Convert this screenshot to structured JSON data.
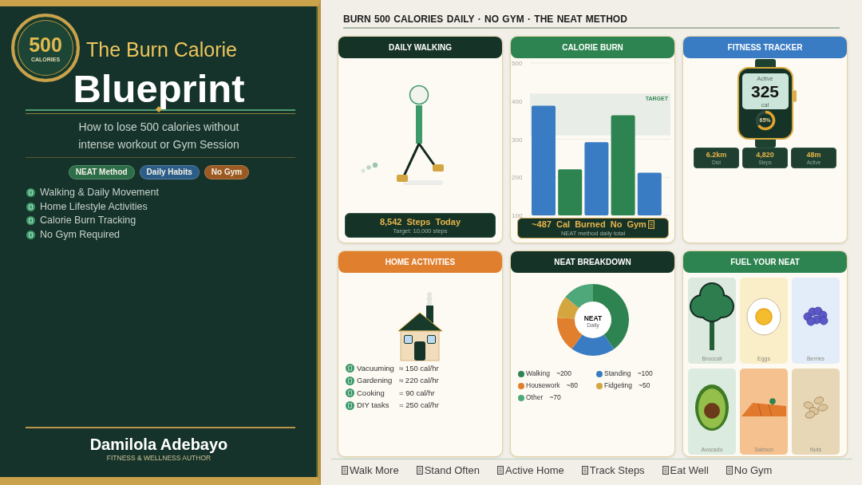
{
  "sidebar": {
    "badge": {
      "value": "500",
      "label": "CALORIES"
    },
    "title": "The Burn Calorie",
    "headline": "Blueprint",
    "subtitle": "How to lose 500 calories without intense workout or Gym Session",
    "tags": [
      {
        "label": "NEAT Method",
        "color": "#2c6e47"
      },
      {
        "label": "Daily Habits",
        "color": "#2b5d88"
      },
      {
        "label": "No Gym",
        "color": "#9b5a22"
      }
    ],
    "features": [
      "Walking & Daily Movement",
      "Home Lifestyle Activities",
      "Calorie Burn Tracking",
      "No Gym Required"
    ],
    "author": {
      "name": "Damilola Adebayo",
      "role": "FITNESS & WELLNESS AUTHOR"
    }
  },
  "header": "BURN 500 CALORIES DAILY · NO GYM · THE NEAT METHOD",
  "cards": [
    {
      "kind": "walking",
      "title": "DAILY WALKING",
      "color": "#163328",
      "summary": "8,542 Steps Today",
      "note": "Target: 10,000 steps"
    },
    {
      "kind": "bar_chart",
      "title": "CALORIE BURN",
      "color": "#2e8450",
      "chart_data": {
        "type": "bar",
        "stacked": true,
        "ylim": [
          100,
          500
        ],
        "yticks": [
          100,
          200,
          300,
          400,
          500
        ],
        "series": [
          {
            "color": "#3a7cc4",
            "values": [
              388,
              null,
              292,
              null,
              212
            ]
          },
          {
            "color": "#2e8450",
            "values": [
              null,
              221,
              null,
              363,
              null
            ]
          }
        ],
        "bands": [
          {
            "axis": "y",
            "from": 310,
            "to": 420,
            "label": "TARGET"
          }
        ]
      },
      "summary": "~487 Cal Burned No Gym",
      "note": "NEAT method daily total"
    },
    {
      "kind": "tracker",
      "title": "FITNESS TRACKER",
      "color": "#3a7cc4",
      "screen_label": "Active",
      "value": "325",
      "unit": "cal",
      "ring": {
        "level": 0.65,
        "label": "65%"
      },
      "stats": [
        {
          "value": "6.2km",
          "label": "Dist"
        },
        {
          "value": "4,820",
          "label": "Steps"
        },
        {
          "value": "48m",
          "label": "Active"
        }
      ]
    },
    {
      "kind": "activities",
      "title": "HOME ACTIVITIES",
      "color": "#e07f2e",
      "activities": [
        {
          "name": "Vacuuming",
          "rate": "≈ 150 cal/hr"
        },
        {
          "name": "Gardening",
          "rate": "≈ 220 cal/hr"
        },
        {
          "name": "Cooking",
          "rate": "= 90 cal/hr"
        },
        {
          "name": "DIY tasks",
          "rate": "= 250 cal/hr"
        }
      ]
    },
    {
      "kind": "donut",
      "title": "NEAT BREAKDOWN",
      "color": "#163328",
      "center_title": "NEAT",
      "center_subtitle": "Daily",
      "chart_data": {
        "type": "donut",
        "categories": [
          "Walking",
          "Standing",
          "Housework",
          "Fidgeting",
          "Other"
        ],
        "values": [
          40,
          20,
          16,
          10,
          14
        ]
      },
      "legend": [
        {
          "value": "~200",
          "color": "#2e8450"
        },
        {
          "value": "~100",
          "color": "#3a7cc4"
        },
        {
          "value": "~80",
          "color": "#e07f2e"
        },
        {
          "value": "~50",
          "color": "#d4a63f"
        },
        {
          "value": "~70",
          "color": "#4fa87a"
        }
      ]
    },
    {
      "kind": "foods",
      "title": "FUEL YOUR NEAT",
      "color": "#2e8450",
      "foods": [
        {
          "kind": "broccoli",
          "name": "Broccoli",
          "color": "#dce9df"
        },
        {
          "kind": "egg",
          "name": "Eggs",
          "color": "#faeec8"
        },
        {
          "kind": "berries",
          "name": "Berries",
          "color": "#e3edf9"
        },
        {
          "kind": "avocado",
          "name": "Avocado",
          "color": "#dcebdf"
        },
        {
          "kind": "salmon",
          "name": "Salmon",
          "color": "#f5c18e"
        },
        {
          "kind": "nuts",
          "name": "Nuts",
          "color": "#e8d7b6"
        }
      ]
    }
  ],
  "tips": [
    "Walk More",
    "Stand Often",
    "Active Home",
    "Track Steps",
    "Eat Well",
    "No Gym"
  ]
}
